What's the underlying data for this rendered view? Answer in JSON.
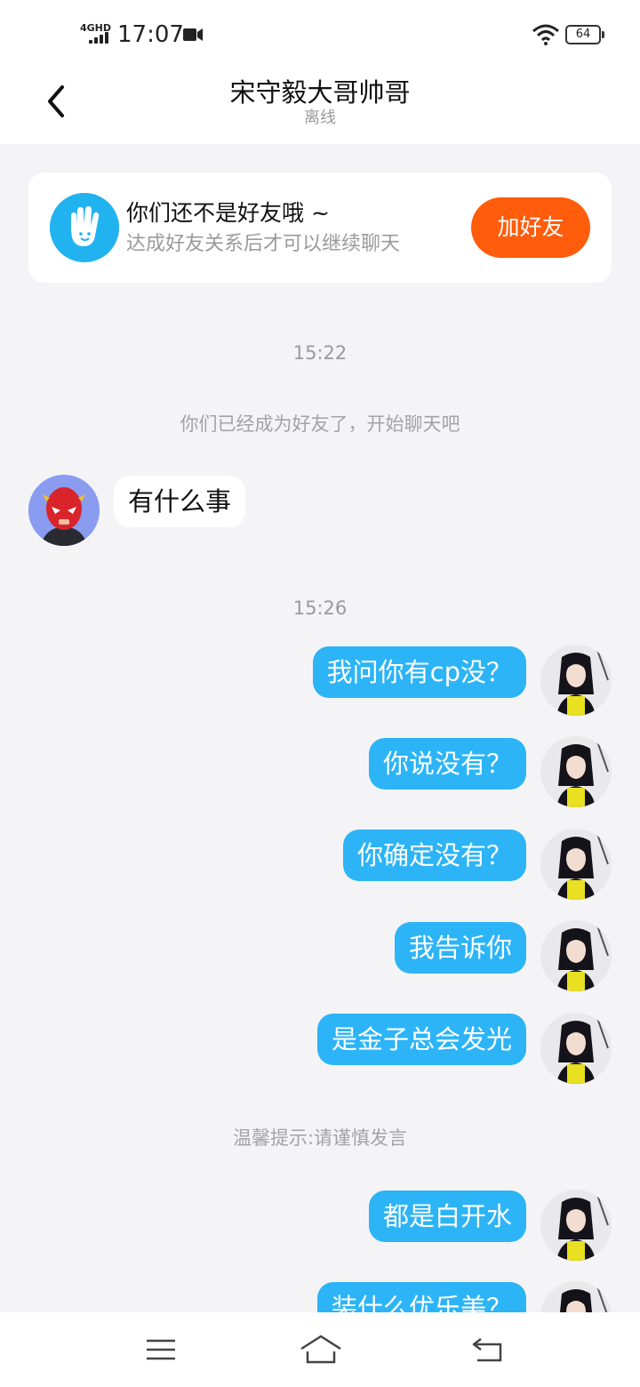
{
  "status_bar": {
    "network": "4GHD",
    "time": "17:07",
    "battery": "64"
  },
  "header": {
    "title": "宋守毅大哥帅哥",
    "status": "离线"
  },
  "friend_card": {
    "title": "你们还不是好友哦 ~",
    "subtitle": "达成好友关系后才可以继续聊天",
    "button": "加好友"
  },
  "messages": {
    "time_1": "15:22",
    "notice_1": "你们已经成为好友了，开始聊天吧",
    "incoming_1": "有什么事",
    "time_2": "15:26",
    "out_1": "我问你有cp没？",
    "out_2": "你说没有？",
    "out_3": "你确定没有？",
    "out_4": "我告诉你",
    "out_5": "是金子总会发光",
    "notice_2": "温馨提示:请谨慎发言",
    "out_6": "都是白开水",
    "out_7": "装什么优乐美？"
  },
  "colors": {
    "accent_blue": "#2cb4f7",
    "add_friend_orange": "#ff5c0c",
    "background": "#f4f4f7"
  }
}
